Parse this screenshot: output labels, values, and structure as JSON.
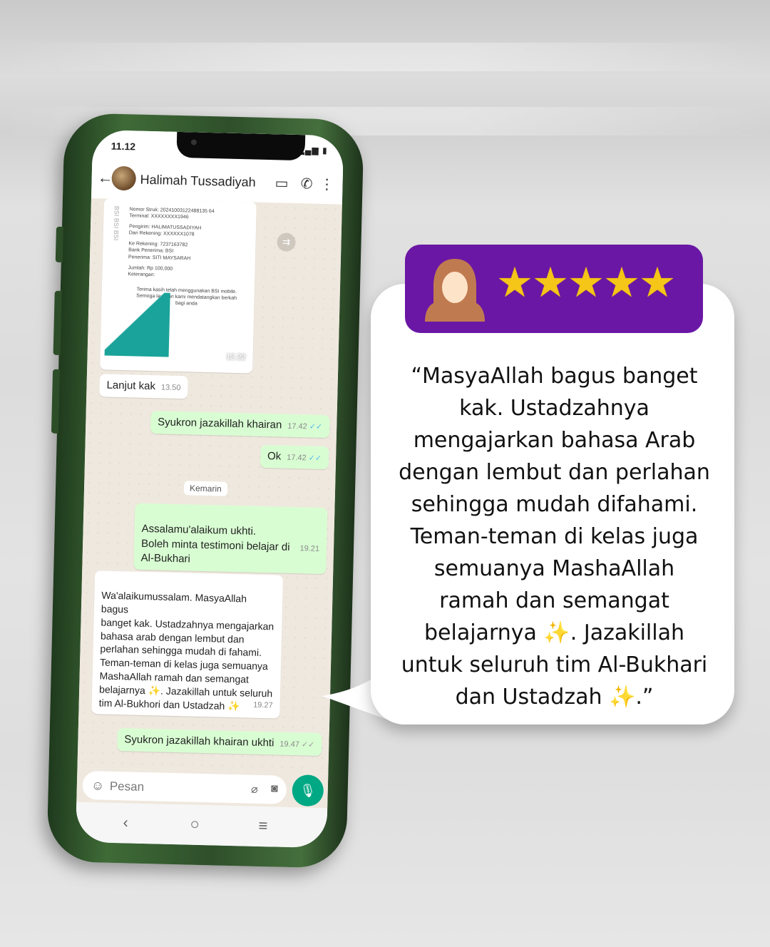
{
  "status": {
    "time": "11.12"
  },
  "contact": {
    "name": "Halimah Tussadiyah"
  },
  "receipt": {
    "brand": "BSI BSI BSI",
    "lines": [
      "Nomor Struk: 20241003122488135 64",
      "Terminal: XXXXXXXX1946",
      "",
      "Pengirim: HALIMATUSSADIYAH",
      "Dari Rekening: XXXXXX1078",
      "",
      "Ke Rekening: 7237163782",
      "Bank Penerima: BSI",
      "Penerima: SITI MAYSARAH",
      "",
      "Jumlah: Rp 100,000",
      "Keterangan:",
      "",
      "Terima kasih telah menggunakan BSI mobile.",
      "Semoga layanan kami mendatangkan berkah",
      "bagi anda"
    ],
    "time": "12.22"
  },
  "messages": [
    {
      "text": "Lanjut kak",
      "time": "13.50"
    },
    {
      "text": "Syukron jazakillah khairan",
      "time": "17.42"
    },
    {
      "text": "Ok",
      "time": "17.42"
    },
    {
      "text": "Assalamu'alaikum ukhti.\nBoleh minta testimoni belajar di\nAl-Bukhari",
      "time": "19.21"
    },
    {
      "text": "Wa'alaikumussalam. MasyaAllah bagus\nbanget kak. Ustadzahnya mengajarkan\nbahasa arab dengan lembut dan\nperlahan sehingga mudah di fahami.\nTeman-teman di kelas juga semuanya\nMashaAllah ramah dan semangat\nbelajarnya ✨. Jazakillah untuk seluruh\ntim Al-Bukhori dan Ustadzah ✨",
      "time": "19.27"
    },
    {
      "text": "Syukron jazakillah khairan ukhti",
      "time": "19.47"
    }
  ],
  "day_divider": "Kemarin",
  "composer": {
    "placeholder": "Pesan"
  },
  "testimonial": {
    "rating": 5,
    "stars": "★★★★★",
    "quote": "“MasyaAllah bagus banget\nkak. Ustadzahnya\nmengajarkan bahasa Arab\ndengan lembut dan perlahan\nsehingga mudah difahami.\nTeman-teman di kelas juga\nsemuanya MashaAllah\nramah dan semangat\nbelajarnya ✨. Jazakillah\nuntuk seluruh tim Al-Bukhari\ndan Ustadzah ✨.”",
    "badge_color": "#6a17a5",
    "star_color": "#f5c518"
  },
  "colors": {
    "phone_green": "#2e4f2a",
    "whatsapp_green": "#00a884",
    "outgoing_bubble": "#d9fdd3",
    "receipt_teal": "#1aa39a"
  }
}
